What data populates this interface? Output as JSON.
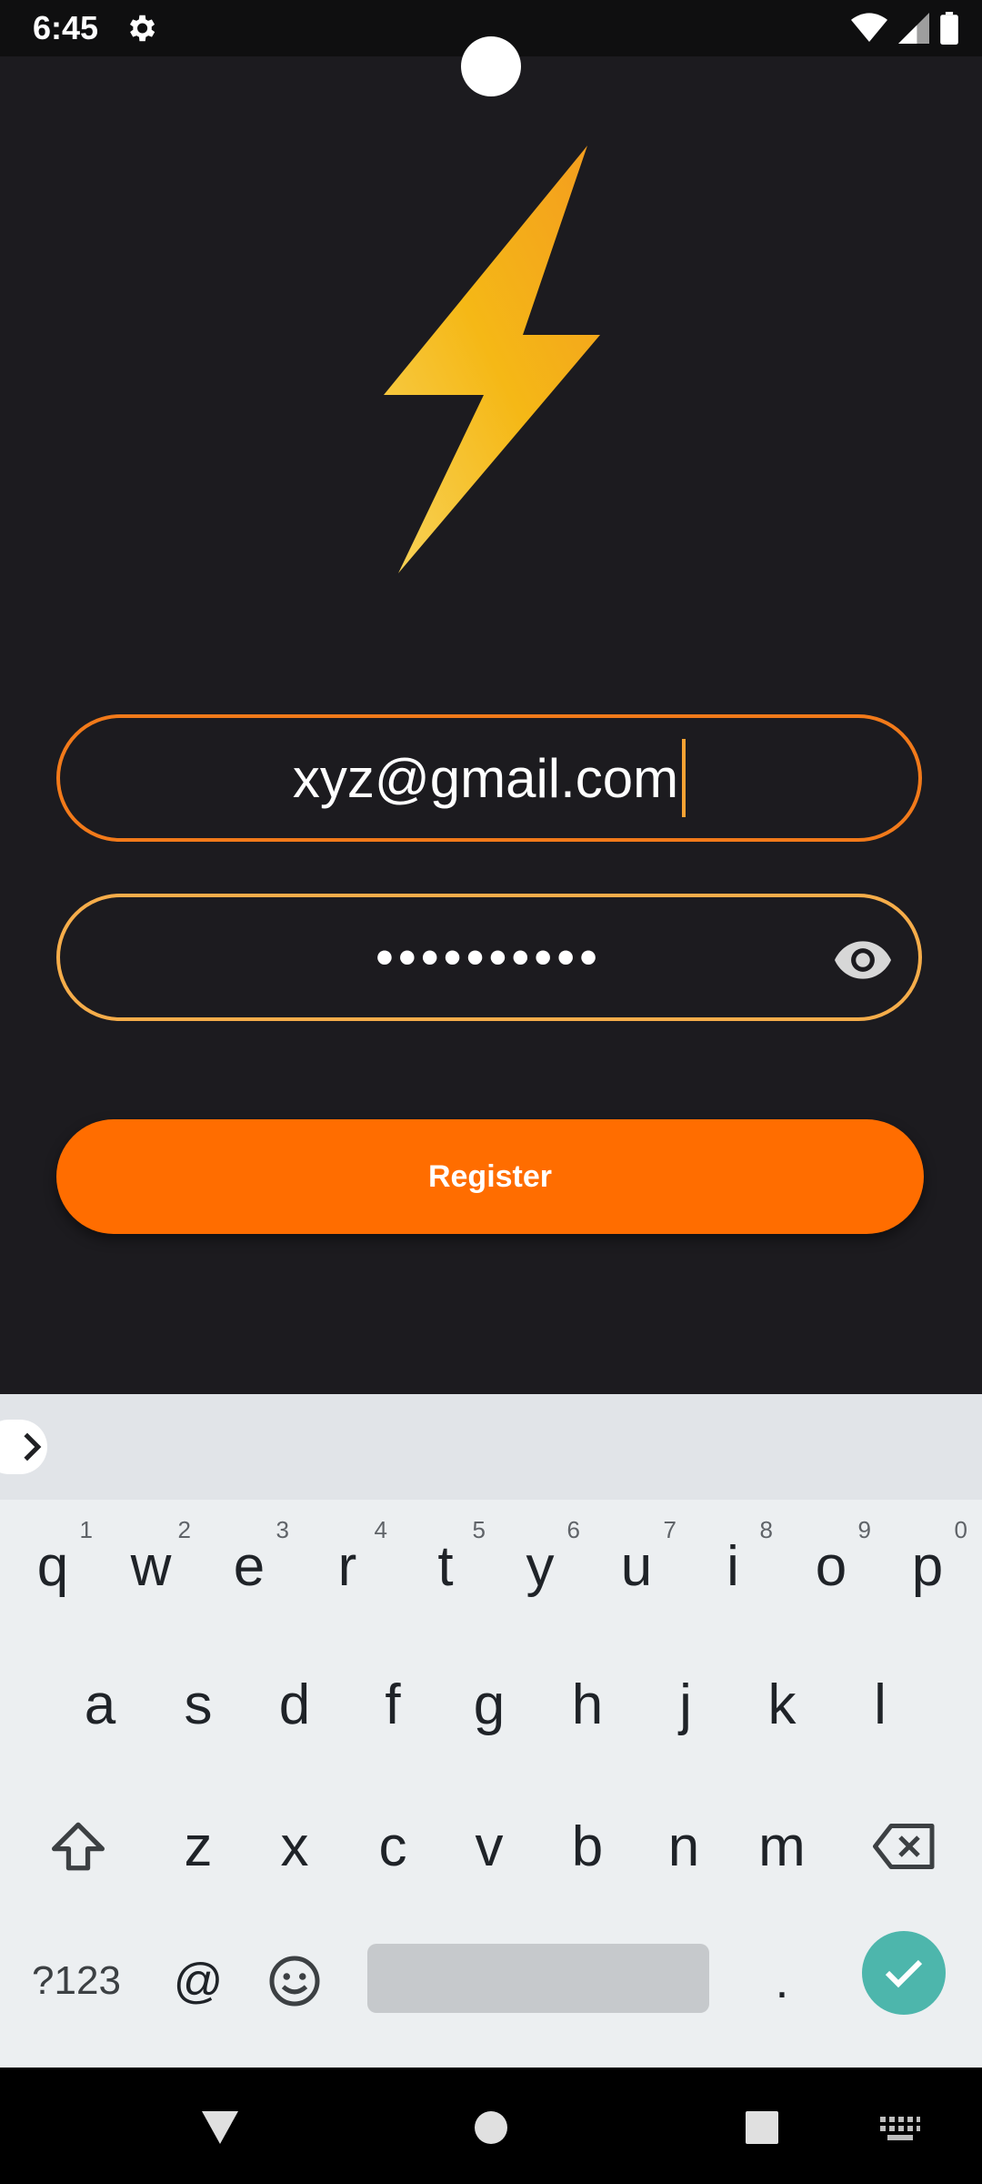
{
  "status_bar": {
    "time": "6:45"
  },
  "form": {
    "email_value": "xyz@gmail.com",
    "password_masked": "••••••••••",
    "register_label": "Register"
  },
  "colors": {
    "background": "#1c1b1f",
    "accent_orange": "#ff6d00",
    "email_border": "#f27a1a",
    "password_border": "#f6ad4a",
    "bolt_top": "#f39c1f",
    "bolt_bottom": "#f8d35a",
    "enter_key": "#4db6ac"
  },
  "keyboard": {
    "row1": [
      {
        "k": "q",
        "n": "1"
      },
      {
        "k": "w",
        "n": "2"
      },
      {
        "k": "e",
        "n": "3"
      },
      {
        "k": "r",
        "n": "4"
      },
      {
        "k": "t",
        "n": "5"
      },
      {
        "k": "y",
        "n": "6"
      },
      {
        "k": "u",
        "n": "7"
      },
      {
        "k": "i",
        "n": "8"
      },
      {
        "k": "o",
        "n": "9"
      },
      {
        "k": "p",
        "n": "0"
      }
    ],
    "row2": [
      "a",
      "s",
      "d",
      "f",
      "g",
      "h",
      "j",
      "k",
      "l"
    ],
    "row3": [
      "z",
      "x",
      "c",
      "v",
      "b",
      "n",
      "m"
    ],
    "row4": {
      "symbols": "?123",
      "at": "@",
      "period": "."
    }
  },
  "icons": [
    "settings-gear-icon",
    "wifi-icon",
    "signal-icon",
    "battery-icon",
    "lightning-bolt-logo",
    "eye-icon",
    "chevron-right-icon",
    "shift-icon",
    "backspace-icon",
    "emoji-icon",
    "check-icon",
    "back-nav-icon",
    "home-nav-icon",
    "recents-nav-icon",
    "keyboard-switch-icon"
  ]
}
